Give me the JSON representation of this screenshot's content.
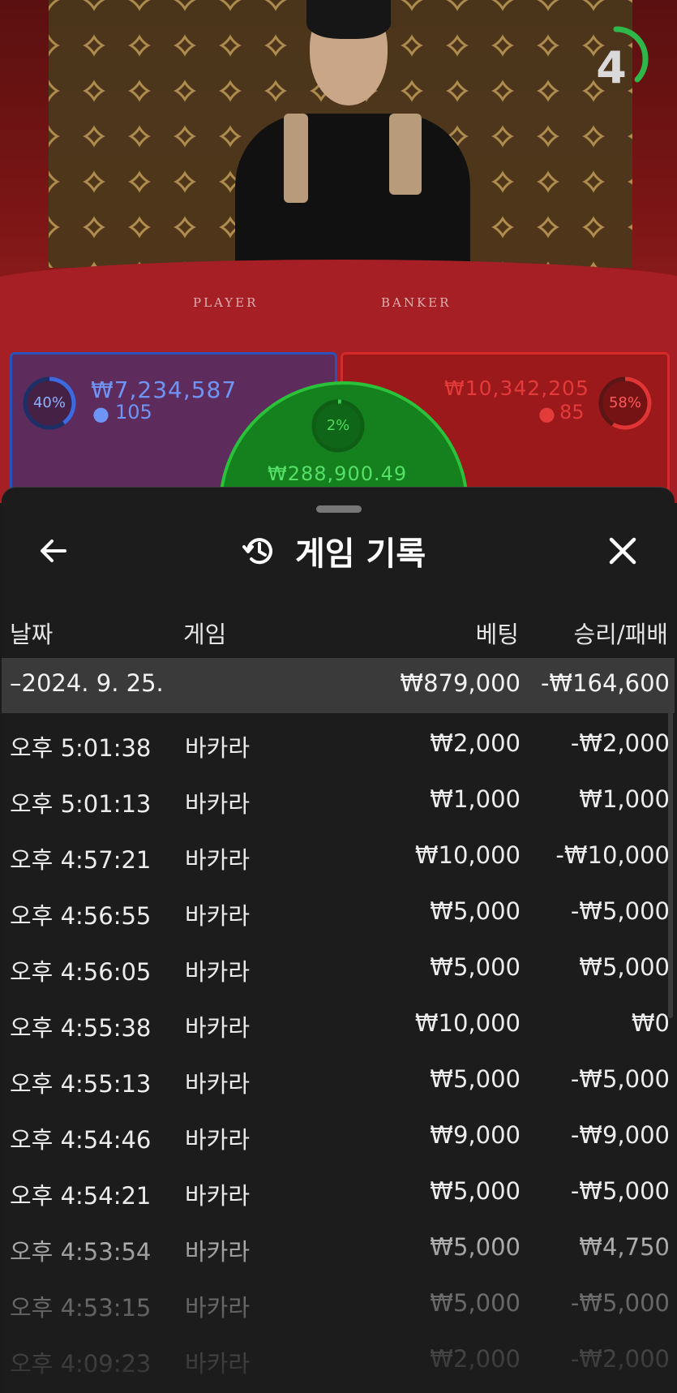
{
  "game_view": {
    "timer": "4",
    "table_labels": {
      "player": "PLAYER",
      "banker": "BANKER"
    },
    "player": {
      "percent": "40%",
      "amount": "₩7,234,587",
      "count": "105"
    },
    "banker": {
      "percent": "58%",
      "amount": "₩10,342,205",
      "count": "85"
    },
    "tie": {
      "percent": "2%",
      "amount": "₩288,900.49"
    },
    "colors": {
      "player": "#2a52b8",
      "banker": "#d42a2a",
      "tie": "#2ac23a"
    }
  },
  "sheet": {
    "title": "게임 기록",
    "icons": {
      "back": "arrow-left-icon",
      "history": "history-icon",
      "close": "close-icon"
    },
    "columns": {
      "date": "날짜",
      "game": "게임",
      "bet": "베팅",
      "win_loss": "승리/패배"
    },
    "summary": {
      "date": "–2024. 9. 25.",
      "bet": "₩879,000",
      "win_loss": "-₩164,600"
    },
    "rows": [
      {
        "time": "오후 5:01:38",
        "game": "바카라",
        "bet": "₩2,000",
        "win_loss": "-₩2,000"
      },
      {
        "time": "오후 5:01:13",
        "game": "바카라",
        "bet": "₩1,000",
        "win_loss": "₩1,000"
      },
      {
        "time": "오후 4:57:21",
        "game": "바카라",
        "bet": "₩10,000",
        "win_loss": "-₩10,000"
      },
      {
        "time": "오후 4:56:55",
        "game": "바카라",
        "bet": "₩5,000",
        "win_loss": "-₩5,000"
      },
      {
        "time": "오후 4:56:05",
        "game": "바카라",
        "bet": "₩5,000",
        "win_loss": "₩5,000"
      },
      {
        "time": "오후 4:55:38",
        "game": "바카라",
        "bet": "₩10,000",
        "win_loss": "₩0"
      },
      {
        "time": "오후 4:55:13",
        "game": "바카라",
        "bet": "₩5,000",
        "win_loss": "-₩5,000"
      },
      {
        "time": "오후 4:54:46",
        "game": "바카라",
        "bet": "₩9,000",
        "win_loss": "-₩9,000"
      },
      {
        "time": "오후 4:54:21",
        "game": "바카라",
        "bet": "₩5,000",
        "win_loss": "-₩5,000"
      },
      {
        "time": "오후 4:53:54",
        "game": "바카라",
        "bet": "₩5,000",
        "win_loss": "₩4,750"
      },
      {
        "time": "오후 4:53:15",
        "game": "바카라",
        "bet": "₩5,000",
        "win_loss": "-₩5,000"
      },
      {
        "time": "오후 4:09:23",
        "game": "바카라",
        "bet": "₩2,000",
        "win_loss": "-₩2,000"
      }
    ]
  }
}
